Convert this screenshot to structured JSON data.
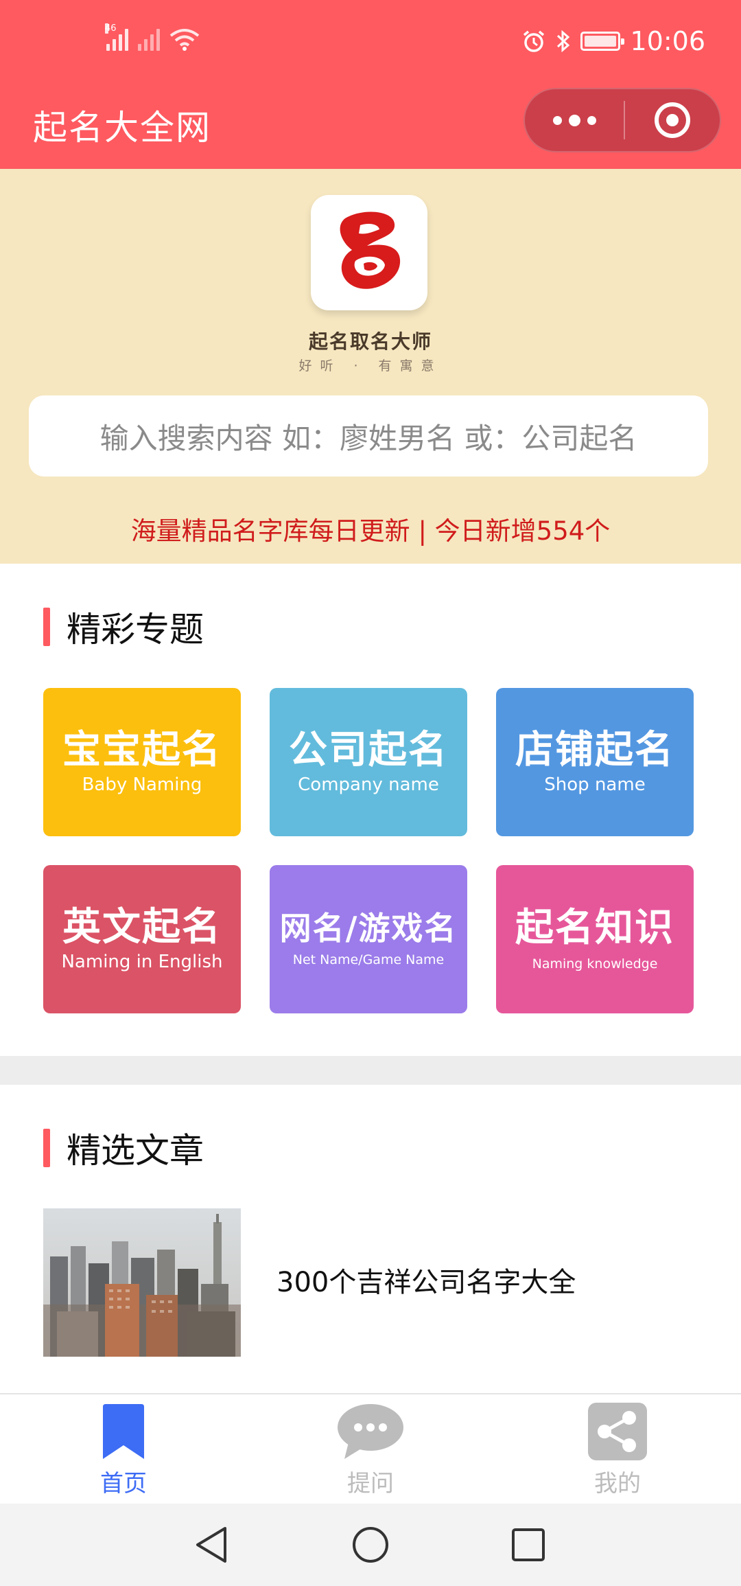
{
  "status_bar": {
    "network_label": "46",
    "time": "10:06",
    "icons": [
      "signal-icon",
      "wifi-icon",
      "alarm-icon",
      "bluetooth-icon",
      "battery-icon"
    ]
  },
  "titlebar": {
    "title": "起名大全网",
    "more_icon": "more-dots-icon",
    "close_icon": "target-circle-icon"
  },
  "hero": {
    "logo_char": "名",
    "logo_name": "起名取名大师",
    "logo_slogan": "好听 · 有寓意",
    "search_placeholder": "输入搜索内容 如：廖姓男名 或：公司起名",
    "promo": "海量精品名字库每日更新 | 今日新增554个"
  },
  "topics": {
    "heading": "精彩专题",
    "tiles": [
      {
        "cn": "宝宝起名",
        "en": "Baby Naming",
        "color": "#fcbf0e"
      },
      {
        "cn": "公司起名",
        "en": "Company name",
        "color": "#62bbdc"
      },
      {
        "cn": "店铺起名",
        "en": "Shop name",
        "color": "#5397e1"
      },
      {
        "cn": "英文起名",
        "en": "Naming in English",
        "color": "#db5366"
      },
      {
        "cn": "网名/游戏名",
        "en": "Net Name/Game Name",
        "color": "#9b7cea"
      },
      {
        "cn": "起名知识",
        "en": "Naming knowledge",
        "color": "#e6579a"
      }
    ]
  },
  "articles": {
    "heading": "精选文章",
    "items": [
      {
        "title": "300个吉祥公司名字大全"
      }
    ]
  },
  "tabbar": {
    "items": [
      {
        "label": "首页",
        "icon": "bookmark-icon",
        "active": true
      },
      {
        "label": "提问",
        "icon": "chat-bubble-icon",
        "active": false
      },
      {
        "label": "我的",
        "icon": "share-icon",
        "active": false
      }
    ],
    "active_color": "#3d6cf5"
  },
  "navbar": {
    "icons": [
      "back-triangle-icon",
      "home-circle-icon",
      "recents-square-icon"
    ]
  }
}
